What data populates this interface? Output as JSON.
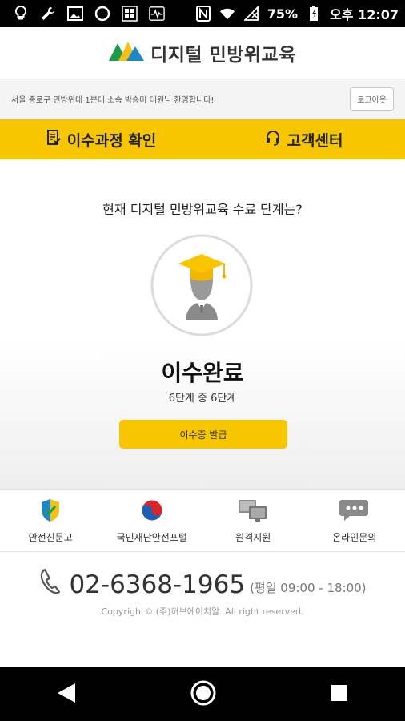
{
  "status_bar": {
    "battery": "75%",
    "time": "오후 12:07"
  },
  "header": {
    "brand": "디지털 민방위교육"
  },
  "welcome": {
    "message": "서울 종로구 민방위대 1분대 소속 박승미 대원님 환영합니다!",
    "logout_label": "로그아웃"
  },
  "nav": {
    "course_check": "이수과정 확인",
    "customer_center": "고객센터"
  },
  "main": {
    "question": "현재 디지털 민방위교육 수료 단계는?",
    "status_title": "이수완료",
    "status_sub": "6단계 중 6단계",
    "progress_steps_completed": 6,
    "progress_steps_total": 6,
    "issue_button": "이수증 발급"
  },
  "links": [
    {
      "label": "안전신문고",
      "icon": "shield-icon"
    },
    {
      "label": "국민재난안전포털",
      "icon": "taegeuk-emblem-icon"
    },
    {
      "label": "원격지원",
      "icon": "remote-monitors-icon"
    },
    {
      "label": "온라인문의",
      "icon": "chat-bubbles-icon"
    }
  ],
  "contact": {
    "phone": "02-6368-1965",
    "hours": "(평일 09:00 - 18:00)",
    "copyright": "Copyright© (주)허브에이치알. All right reserved."
  },
  "colors": {
    "accent": "#f7c600",
    "text": "#222222"
  }
}
